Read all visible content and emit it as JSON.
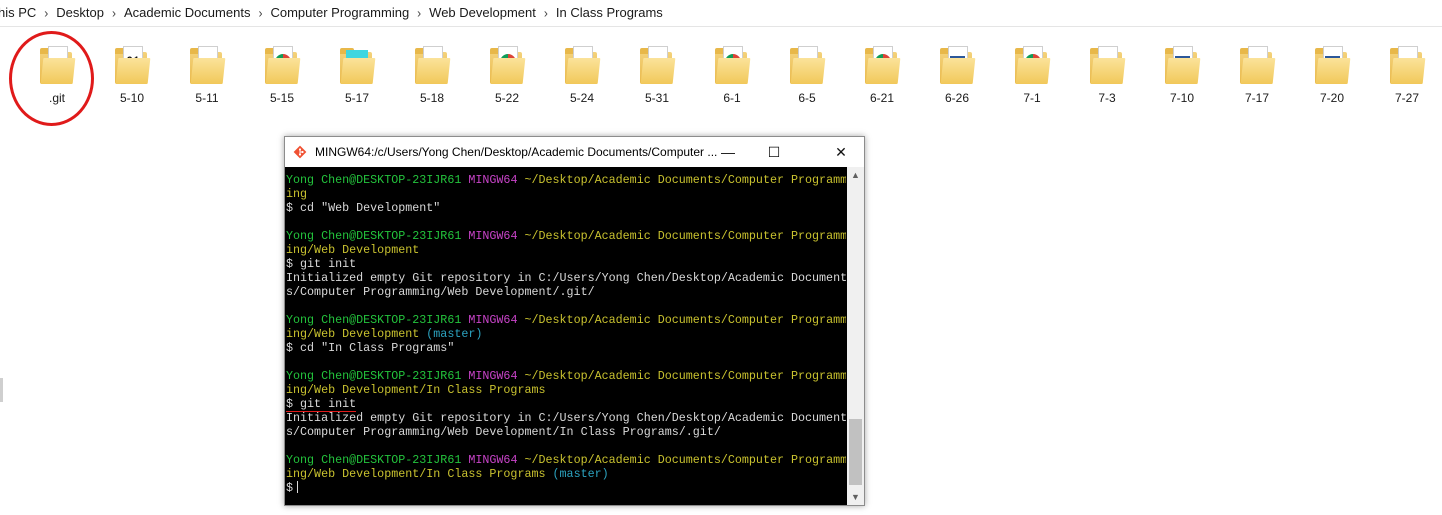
{
  "breadcrumb": [
    "his PC",
    "Desktop",
    "Academic Documents",
    "Computer Programming",
    "Web Development",
    "In Class Programs"
  ],
  "files": [
    {
      "label": ".git",
      "type": "folder-plain"
    },
    {
      "label": "5-10",
      "type": "folder-binary"
    },
    {
      "label": "5-11",
      "type": "folder-paper"
    },
    {
      "label": "5-15",
      "type": "folder-chrome"
    },
    {
      "label": "5-17",
      "type": "folder-cyan"
    },
    {
      "label": "5-18",
      "type": "folder-paper"
    },
    {
      "label": "5-22",
      "type": "folder-chrome"
    },
    {
      "label": "5-24",
      "type": "folder-paper"
    },
    {
      "label": "5-31",
      "type": "folder-paper"
    },
    {
      "label": "6-1",
      "type": "folder-chrome-blue"
    },
    {
      "label": "6-5",
      "type": "folder-paper"
    },
    {
      "label": "6-21",
      "type": "folder-chrome"
    },
    {
      "label": "6-26",
      "type": "folder-word"
    },
    {
      "label": "7-1",
      "type": "folder-chrome"
    },
    {
      "label": "7-3",
      "type": "folder-paper"
    },
    {
      "label": "7-10",
      "type": "folder-word"
    },
    {
      "label": "7-17",
      "type": "folder-paper"
    },
    {
      "label": "7-20",
      "type": "folder-word"
    },
    {
      "label": "7-27",
      "type": "folder-paper"
    }
  ],
  "terminal": {
    "title": "MINGW64:/c/Users/Yong Chen/Desktop/Academic Documents/Computer ...",
    "icon": "git-diamond-icon",
    "buttons": {
      "minimize": "—",
      "maximize": "☐",
      "close": "✕"
    },
    "lines": [
      [
        {
          "t": "Yong Chen@DESKTOP-23IJR61",
          "c": "g"
        },
        {
          "t": " ",
          "c": "w"
        },
        {
          "t": "MINGW64",
          "c": "m"
        },
        {
          "t": " ~/Desktop/Academic Documents/Computer Programm",
          "c": "y"
        }
      ],
      [
        {
          "t": "ing",
          "c": "y"
        }
      ],
      [
        {
          "t": "$ cd \"Web Development\"",
          "c": "w"
        }
      ],
      [],
      [
        {
          "t": "Yong Chen@DESKTOP-23IJR61",
          "c": "g"
        },
        {
          "t": " ",
          "c": "w"
        },
        {
          "t": "MINGW64",
          "c": "m"
        },
        {
          "t": " ~/Desktop/Academic Documents/Computer Programm",
          "c": "y"
        }
      ],
      [
        {
          "t": "ing/Web Development",
          "c": "y"
        }
      ],
      [
        {
          "t": "$ git init",
          "c": "w"
        }
      ],
      [
        {
          "t": "Initialized empty Git repository in C:/Users/Yong Chen/Desktop/Academic Document",
          "c": "w"
        }
      ],
      [
        {
          "t": "s/Computer Programming/Web Development/.git/",
          "c": "w"
        }
      ],
      [],
      [
        {
          "t": "Yong Chen@DESKTOP-23IJR61",
          "c": "g"
        },
        {
          "t": " ",
          "c": "w"
        },
        {
          "t": "MINGW64",
          "c": "m"
        },
        {
          "t": " ~/Desktop/Academic Documents/Computer Programm",
          "c": "y"
        }
      ],
      [
        {
          "t": "ing/Web Development",
          "c": "y"
        },
        {
          "t": " (master)",
          "c": "c"
        }
      ],
      [
        {
          "t": "$ cd \"In Class Programs\"",
          "c": "w"
        }
      ],
      [],
      [
        {
          "t": "Yong Chen@DESKTOP-23IJR61",
          "c": "g"
        },
        {
          "t": " ",
          "c": "w"
        },
        {
          "t": "MINGW64",
          "c": "m"
        },
        {
          "t": " ~/Desktop/Academic Documents/Computer Programm",
          "c": "y"
        }
      ],
      [
        {
          "t": "ing/Web Development/In Class Programs",
          "c": "y"
        }
      ],
      [
        {
          "t": "$ git init",
          "c": "w",
          "u": true
        }
      ],
      [
        {
          "t": "Initialized empty Git repository in C:/Users/Yong Chen/Desktop/Academic Document",
          "c": "w"
        }
      ],
      [
        {
          "t": "s/Computer Programming/Web Development/In Class Programs/.git/",
          "c": "w"
        }
      ],
      [],
      [
        {
          "t": "Yong Chen@DESKTOP-23IJR61",
          "c": "g"
        },
        {
          "t": " ",
          "c": "w"
        },
        {
          "t": "MINGW64",
          "c": "m"
        },
        {
          "t": " ~/Desktop/Academic Documents/Computer Programm",
          "c": "y"
        }
      ],
      [
        {
          "t": "ing/Web Development/In Class Programs",
          "c": "y"
        },
        {
          "t": " (master)",
          "c": "c"
        }
      ],
      [
        {
          "t": "$",
          "c": "w",
          "cursor": true
        }
      ]
    ]
  },
  "colors": {
    "prompt_user": "#23c33c",
    "prompt_env": "#c843c8",
    "prompt_path": "#c9c22f",
    "branch": "#2ca3c0",
    "highlight_circle": "#e01a1a"
  }
}
